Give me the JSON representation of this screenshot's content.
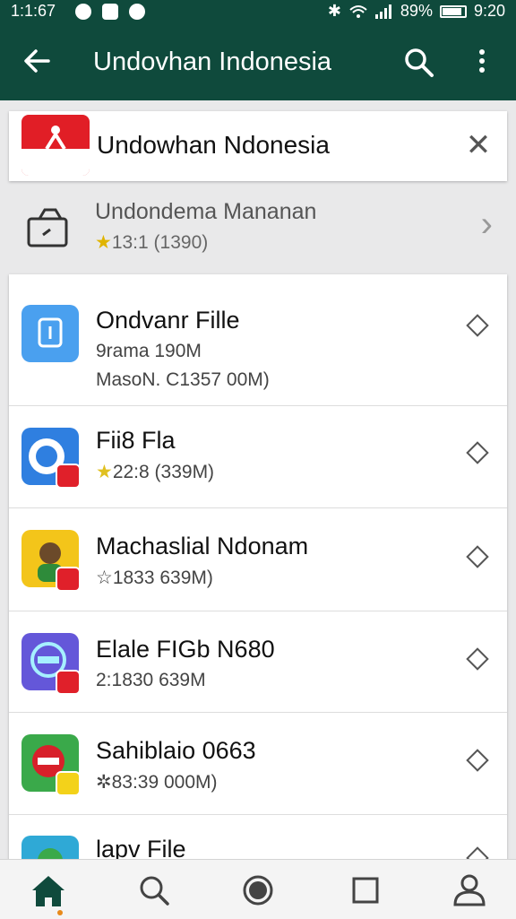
{
  "status_bar": {
    "time_left": "1:1:67",
    "battery_pct": "89%",
    "time_right": "9:20"
  },
  "app_bar": {
    "title": "Undovhan Indonesia",
    "icons": [
      "back-arrow-icon",
      "search-icon",
      "more-vert-icon"
    ]
  },
  "search": {
    "query": "Undowhan Ndonesia",
    "clear_icon": "close-icon"
  },
  "suggestion": {
    "title": "Undondema Mananan",
    "rating": "13:1 (1390)",
    "icon": "briefcase-icon"
  },
  "apps": [
    {
      "name": "Ondvanr Fille",
      "line1": "9rama 190M",
      "line2": "MasoN. C1357 00M)",
      "icon_color": "#4aa0ef"
    },
    {
      "name": "Fii8 Fla",
      "line1": "22:8 (339M)",
      "star": "filled",
      "icon_color": "#2f7fe0"
    },
    {
      "name": "Machaslial Ndonam",
      "line1": "1833 639M)",
      "star": "outline",
      "icon_color": "#f3c51a"
    },
    {
      "name": "Elale FIGb N680",
      "line1": "2:1830 639M",
      "icon_color": "#6457d9"
    },
    {
      "name": "Sahiblaio 0663",
      "line1": "83:39 000M)",
      "star": "sparkle",
      "icon_color": "#3aa94a"
    },
    {
      "name": "lapv File",
      "line1": "",
      "icon_color": "#2fa9d6"
    }
  ],
  "bottom_nav": [
    "home-icon",
    "search-icon",
    "record-icon",
    "square-icon",
    "person-icon"
  ],
  "colors": {
    "primary": "#0f4a3c",
    "accent": "#e88a1a",
    "star": "#e0b400"
  }
}
